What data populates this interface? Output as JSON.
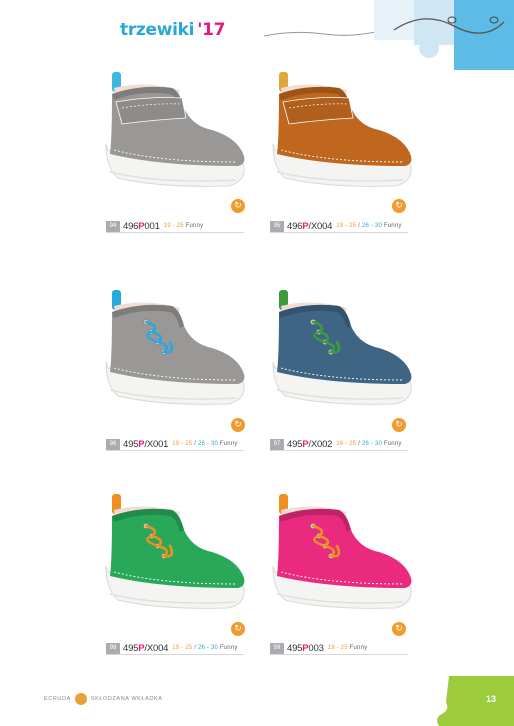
{
  "header": {
    "title_word": "trzewiki",
    "title_year": "'17"
  },
  "products": [
    {
      "badge": "94",
      "code_prefix": "496",
      "code_p": "P",
      "code_suffix": "001",
      "sizes": [
        {
          "text": "19 - 25",
          "cls": "s1"
        },
        {
          "text": " Funny",
          "cls": ""
        }
      ],
      "shoe_color": "#9a9896",
      "accent": "#3fb6e2",
      "closure": "velcro"
    },
    {
      "badge": "95",
      "code_prefix": "496",
      "code_p": "P",
      "code_suffix": "/X004",
      "sizes": [
        {
          "text": "19 - 25",
          "cls": "s1"
        },
        {
          "text": " / ",
          "cls": ""
        },
        {
          "text": "26 - 30",
          "cls": "s2"
        },
        {
          "text": " Funny",
          "cls": ""
        }
      ],
      "shoe_color": "#c0671f",
      "accent": "#e0a63b",
      "closure": "velcro"
    },
    {
      "badge": "96",
      "code_prefix": "495",
      "code_p": "P",
      "code_suffix": "/X001",
      "sizes": [
        {
          "text": "19 - 25",
          "cls": "s1"
        },
        {
          "text": " / ",
          "cls": ""
        },
        {
          "text": "26 - 30",
          "cls": "s2"
        },
        {
          "text": " Funny",
          "cls": ""
        }
      ],
      "shoe_color": "#9a9896",
      "accent": "#27a9dd",
      "closure": "laces"
    },
    {
      "badge": "97",
      "code_prefix": "495",
      "code_p": "P",
      "code_suffix": "/X002",
      "sizes": [
        {
          "text": "19 - 25",
          "cls": "s1"
        },
        {
          "text": " / ",
          "cls": ""
        },
        {
          "text": "26 - 30",
          "cls": "s2"
        },
        {
          "text": " Funny",
          "cls": ""
        }
      ],
      "shoe_color": "#3f6585",
      "accent": "#3d9b3f",
      "closure": "laces"
    },
    {
      "badge": "98",
      "code_prefix": "495",
      "code_p": "P",
      "code_suffix": "/X004",
      "sizes": [
        {
          "text": "19 - 25",
          "cls": "s1"
        },
        {
          "text": " / ",
          "cls": ""
        },
        {
          "text": "26 - 30",
          "cls": "s2"
        },
        {
          "text": " Funny",
          "cls": ""
        }
      ],
      "shoe_color": "#2aa85a",
      "accent": "#ef8f22",
      "closure": "laces"
    },
    {
      "badge": "99",
      "code_prefix": "495",
      "code_p": "P",
      "code_suffix": "003",
      "sizes": [
        {
          "text": "19 - 25",
          "cls": "s1"
        },
        {
          "text": " Funny",
          "cls": ""
        }
      ],
      "shoe_color": "#ea2a7e",
      "accent": "#ef8f22",
      "closure": "laces"
    }
  ],
  "footer": {
    "left_text": "ECRUDA",
    "right_text": "SKŁODZANA WKŁADKA",
    "page_number": "13"
  }
}
